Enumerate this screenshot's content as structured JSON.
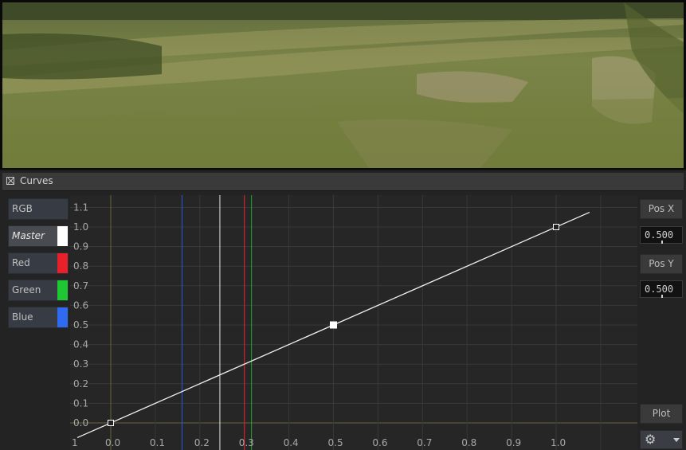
{
  "panel": {
    "title": "Curves"
  },
  "channels": [
    {
      "label": "RGB",
      "swatch": null,
      "active": false
    },
    {
      "label": "Master",
      "swatch": "#ffffff",
      "active": true
    },
    {
      "label": "Red",
      "swatch": "#e8202a",
      "active": false
    },
    {
      "label": "Green",
      "swatch": "#1fc832",
      "active": false
    },
    {
      "label": "Blue",
      "swatch": "#2f6bf0",
      "active": false
    }
  ],
  "side": {
    "pos_x_label": "Pos X",
    "pos_x_value": "0.500",
    "pos_y_label": "Pos Y",
    "pos_y_value": "0.500",
    "plot_label": "Plot",
    "settings_icon": "gear-icon",
    "dropdown_icon": "chevron-down-icon"
  },
  "graph": {
    "y_ticks": [
      "1.1",
      "1.0",
      "0.9",
      "0.8",
      "0.7",
      "0.6",
      "0.5",
      "0.4",
      "0.3",
      "0.2",
      "0.1",
      "0.0"
    ],
    "x_ticks": [
      "0.0",
      "0.1",
      "0.2",
      "0.3",
      "0.4",
      "0.5",
      "0.6",
      "0.7",
      "0.8",
      "0.9",
      "1.0"
    ],
    "corner_label": "1",
    "control_points": [
      [
        0.0,
        0.0
      ],
      [
        0.5,
        0.5
      ],
      [
        1.0,
        1.0
      ]
    ],
    "selected_point": [
      0.5,
      0.5
    ],
    "reference_lines": [
      {
        "channel": "Blue",
        "x": 0.16,
        "color": "#2f55e0"
      },
      {
        "channel": "Master",
        "x": 0.245,
        "color": "#e6e6e6"
      },
      {
        "channel": "Red",
        "x": 0.3,
        "color": "#e8202a"
      },
      {
        "channel": "Green",
        "x": 0.316,
        "color": "#1fa832"
      }
    ]
  }
}
